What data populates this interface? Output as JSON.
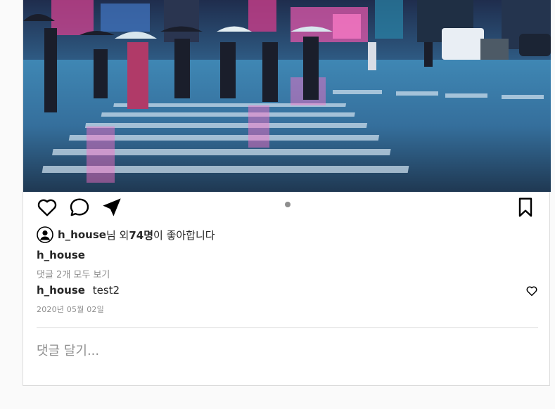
{
  "post": {
    "liked_by_user": "h_house",
    "liked_by_suffix": "님 외 ",
    "like_count_text": "74명",
    "likes_suffix": "이 좋아합니다",
    "author": "h_house",
    "view_all_comments": "댓글 2개 모두 보기",
    "comments": [
      {
        "user": "h_house",
        "text": "test2"
      }
    ],
    "date": "2020년 05월 02일",
    "comment_placeholder": "댓글 달기..."
  },
  "icons": {
    "like": "heart-icon",
    "comment": "speech-bubble-icon",
    "share": "paper-plane-icon",
    "save": "bookmark-icon",
    "avatar": "user-avatar-icon"
  },
  "colors": {
    "text": "#262626",
    "muted": "#8e8e8e",
    "border": "#dbdbdb",
    "background": "#fafafa"
  }
}
